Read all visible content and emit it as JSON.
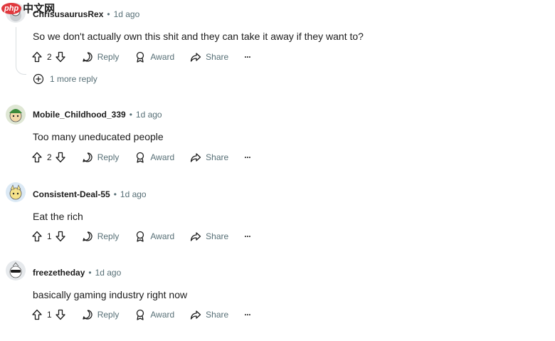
{
  "watermark": {
    "php": "php",
    "site": "中文网"
  },
  "comments": [
    {
      "author": "ChrisusaurusRex",
      "age": "1d ago",
      "text": "So we don't actually own this shit and they can take it away if they want to?",
      "votes": "2",
      "reply": "Reply",
      "award": "Award",
      "share": "Share",
      "more": "···"
    },
    {
      "author": "Mobile_Childhood_339",
      "age": "1d ago",
      "text": "Too many uneducated people",
      "votes": "2",
      "reply": "Reply",
      "award": "Award",
      "share": "Share",
      "more": "···"
    },
    {
      "author": "Consistent-Deal-55",
      "age": "1d ago",
      "text": "Eat the rich",
      "votes": "1",
      "reply": "Reply",
      "award": "Award",
      "share": "Share",
      "more": "···"
    },
    {
      "author": "freezetheday",
      "age": "1d ago",
      "text": "basically gaming industry right now",
      "votes": "1",
      "reply": "Reply",
      "award": "Award",
      "share": "Share",
      "more": "···"
    }
  ],
  "more_replies": "1 more reply",
  "separator": "•"
}
